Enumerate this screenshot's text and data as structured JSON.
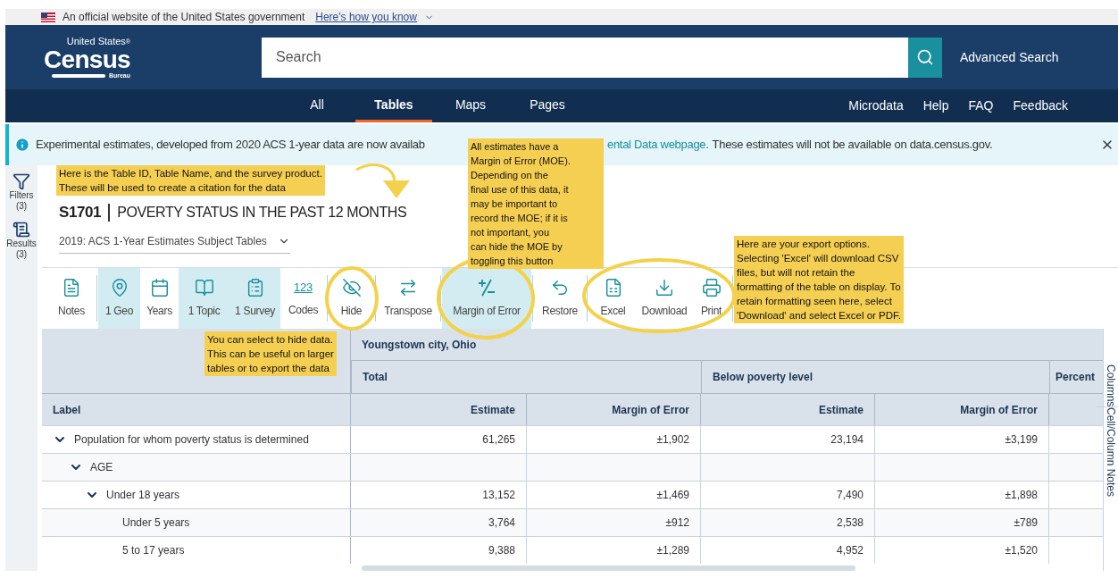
{
  "gov_banner": {
    "text": "An official website of the United States government",
    "link": "Here's how you know"
  },
  "header": {
    "logo": {
      "top": "United States",
      "mark": "®",
      "name": "Census",
      "bottom": "Bureau"
    },
    "search": {
      "placeholder": "Search"
    },
    "advanced_search": "Advanced Search"
  },
  "nav": {
    "tabs": [
      {
        "label": "All",
        "selected": false
      },
      {
        "label": "Tables",
        "selected": true
      },
      {
        "label": "Maps",
        "selected": false
      },
      {
        "label": "Pages",
        "selected": false
      }
    ],
    "links": [
      "Microdata",
      "Help",
      "FAQ",
      "Feedback"
    ]
  },
  "info_banner": {
    "text_before": "Experimental estimates, developed from 2020 ACS 1-year data are now availab",
    "link": "ental Data webpage.",
    "text_after": "These estimates will not be available on data.census.gov."
  },
  "sidebar": [
    {
      "label": "Filters",
      "count": "(3)"
    },
    {
      "label": "Results",
      "count": "(3)"
    }
  ],
  "table_title": {
    "id": "S1701",
    "name": "POVERTY STATUS IN THE PAST 12 MONTHS",
    "product": "2019: ACS 1-Year Estimates Subject Tables"
  },
  "toolbar": [
    {
      "label": "Notes",
      "selected": false
    },
    {
      "label": "1 Geo",
      "selected": true
    },
    {
      "label": "Years",
      "selected": false
    },
    {
      "label": "1 Topic",
      "selected": true
    },
    {
      "label": "1 Survey",
      "selected": true
    },
    {
      "label": "Codes",
      "selected": false,
      "glyph": "123"
    },
    {
      "label": "Hide",
      "selected": false
    },
    {
      "label": "Transpose",
      "selected": false
    },
    {
      "label": "Margin of Error",
      "selected": true
    },
    {
      "label": "Restore",
      "selected": false
    },
    {
      "label": "Excel",
      "selected": false
    },
    {
      "label": "Download",
      "selected": false
    },
    {
      "label": "Print",
      "selected": false
    }
  ],
  "table": {
    "geo": "Youngstown city, Ohio",
    "groups": [
      "Total",
      "Below poverty level",
      "Percent"
    ],
    "label_header": "Label",
    "columns": [
      "Estimate",
      "Margin of Error",
      "Estimate",
      "Margin of Error"
    ],
    "rows": [
      {
        "label": "Population for whom poverty status is determined",
        "expanded": true,
        "values": [
          "61,265",
          "±1,902",
          "23,194",
          "±3,199"
        ],
        "children": [
          {
            "label": "AGE",
            "expanded": true,
            "children": [
              {
                "label": "Under 18 years",
                "expanded": true,
                "values": [
                  "13,152",
                  "±1,469",
                  "7,490",
                  "±1,898"
                ],
                "children": [
                  {
                    "label": "Under 5 years",
                    "values": [
                      "3,764",
                      "±912",
                      "2,538",
                      "±789"
                    ]
                  },
                  {
                    "label": "5 to 17 years",
                    "values": [
                      "9,388",
                      "±1,289",
                      "4,952",
                      "±1,520"
                    ]
                  }
                ]
              }
            ]
          }
        ]
      }
    ]
  },
  "side_tabs": [
    "Columns",
    "Cell/Column Notes"
  ],
  "callouts": [
    "Here is the Table ID, Table Name, and the survey product.\nThese will be used to create a citation for the data",
    "All estimates have a\nMargin of Error (MOE).\nDepending on the\nfinal use of this data, it\nmay be important to\nrecord the MOE; if it is\nnot important, you\ncan hide the MOE by\ntoggling this button",
    "You can select to hide data.\nThis can be useful on larger\ntables or to export the data",
    "Here are your export options.\nSelecting 'Excel' will download CSV\nfiles, but will not retain the\nformatting of the table on display. To\nretain formatting seen here, select\n'Download' and select Excel or PDF."
  ]
}
